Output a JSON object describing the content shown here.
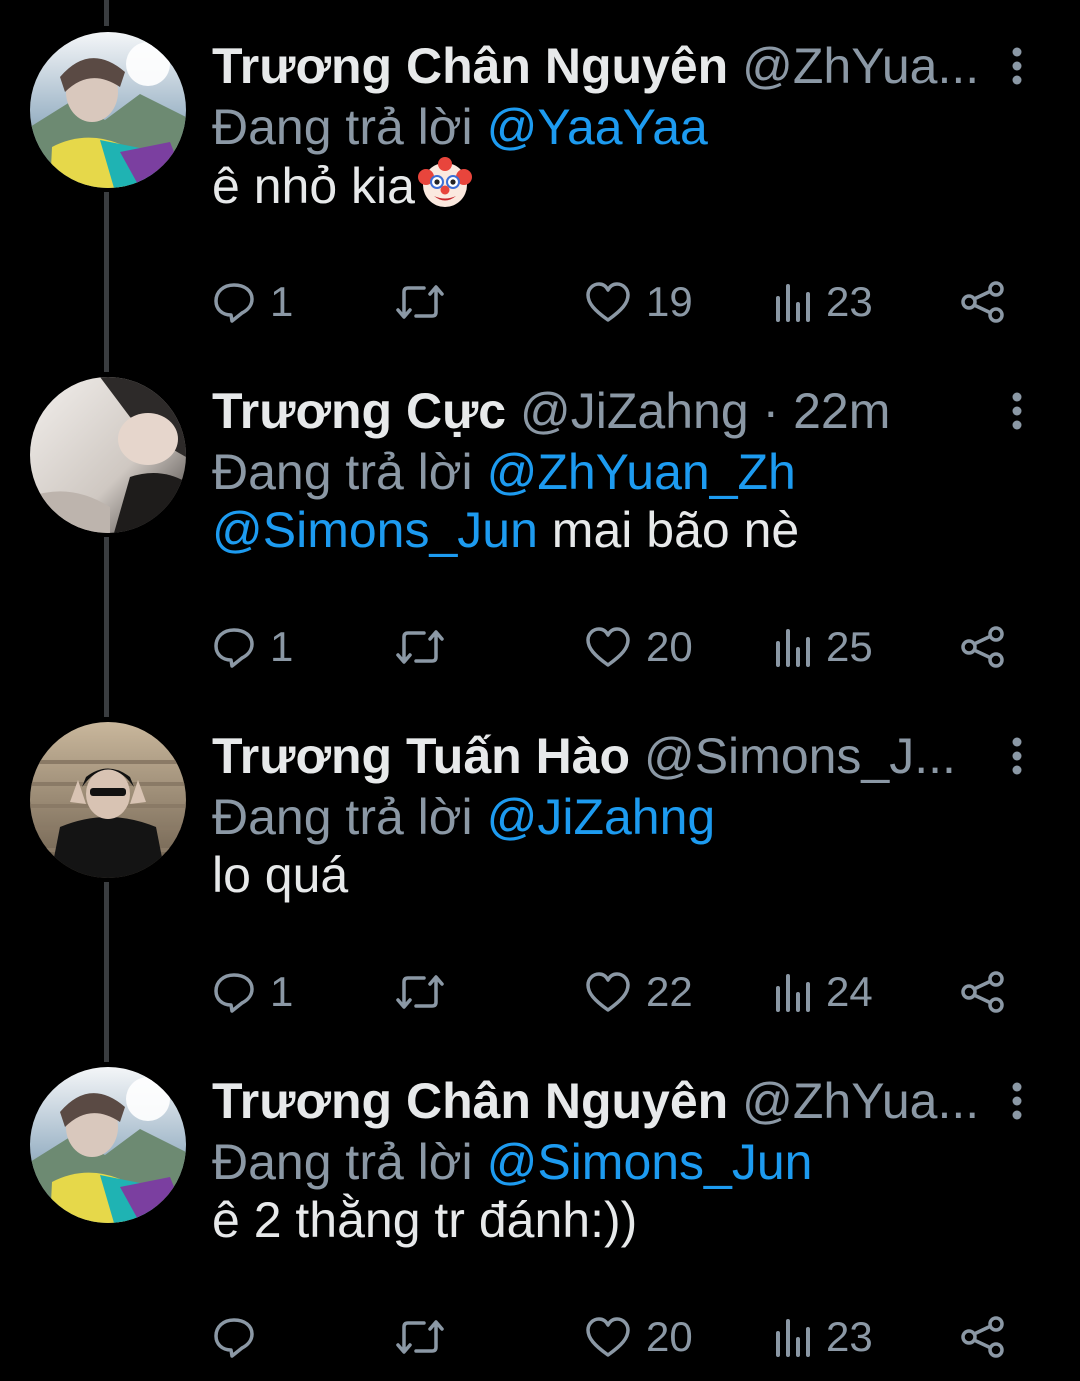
{
  "reply_prefix": "Đang trả lời",
  "colors": {
    "background": "#000000",
    "text": "#e7e9ea",
    "muted": "#8b98a5",
    "accent": "#1d9bf0"
  },
  "tweets": [
    {
      "name": "Trương Chân Nguyên",
      "handle": "@ZhYua...",
      "time": "",
      "reply_to": "@YaaYaa",
      "text": "ê nhỏ kia",
      "mention": "",
      "emoji": "clown-face-icon",
      "replies": "1",
      "likes": "19",
      "views": "23",
      "avatar": "avatar-mountain"
    },
    {
      "name": "Trương Cực",
      "handle": "@JiZahng",
      "time": "· 22m",
      "reply_to": "@ZhYuan_Zh",
      "mention": "@Simons_Jun",
      "text": " mai bão nè",
      "replies": "1",
      "likes": "20",
      "views": "25",
      "avatar": "avatar-light"
    },
    {
      "name": "Trương Tuấn Hào",
      "handle": "@Simons_J...",
      "time": "",
      "reply_to": "@JiZahng",
      "text": "lo quá",
      "mention": "",
      "replies": "1",
      "likes": "22",
      "views": "24",
      "avatar": "avatar-stairs"
    },
    {
      "name": "Trương Chân Nguyên",
      "handle": "@ZhYua...",
      "time": "",
      "reply_to": "@Simons_Jun",
      "text": "ê 2 thằng tr đánh:))",
      "mention": "",
      "replies": "",
      "likes": "20",
      "views": "23",
      "avatar": "avatar-mountain"
    }
  ]
}
